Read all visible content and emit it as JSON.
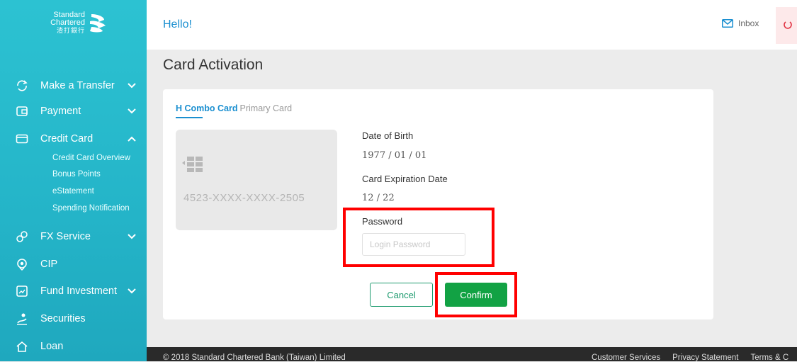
{
  "brand": {
    "line1": "Standard",
    "line2": "Chartered",
    "line3": "渣打銀行"
  },
  "header": {
    "greeting": "Hello!",
    "inbox_label": "Inbox"
  },
  "sidebar": {
    "items": [
      {
        "label": "Make a Transfer",
        "icon": "transfer-icon"
      },
      {
        "label": "Payment",
        "icon": "payment-icon"
      },
      {
        "label": "Credit Card",
        "icon": "credit-card-icon",
        "expanded": true
      },
      {
        "label": "FX Service",
        "icon": "fx-icon"
      },
      {
        "label": "CIP",
        "icon": "cip-icon"
      },
      {
        "label": "Fund Investment",
        "icon": "fund-icon"
      },
      {
        "label": "Securities",
        "icon": "securities-icon"
      },
      {
        "label": "Loan",
        "icon": "loan-icon"
      }
    ],
    "credit_card_subitems": [
      "Credit Card Overview",
      "Bonus Points",
      "eStatement",
      "Spending Notification"
    ]
  },
  "page": {
    "title": "Card Activation",
    "tab_main": "H Combo Card",
    "tab_sub": "Primary Card",
    "card_number": "4523-XXXX-XXXX-2505",
    "dob_label": "Date of Birth",
    "dob_value": "1977 / 01 / 01",
    "expiry_label": "Card Expiration Date",
    "expiry_value": "12 / 22",
    "password_label": "Password",
    "password_placeholder": "Login Password",
    "password_value": "",
    "cancel_label": "Cancel",
    "confirm_label": "Confirm"
  },
  "footer": {
    "copyright": "© 2018 Standard Chartered Bank (Taiwan) Limited",
    "links": [
      "Customer Services",
      "Privacy Statement",
      "Terms & C"
    ]
  },
  "colors": {
    "sidebar": "#24b4c8",
    "accent_blue": "#1a8fd0",
    "confirm_green": "#12a244",
    "highlight": "#ff0000"
  }
}
